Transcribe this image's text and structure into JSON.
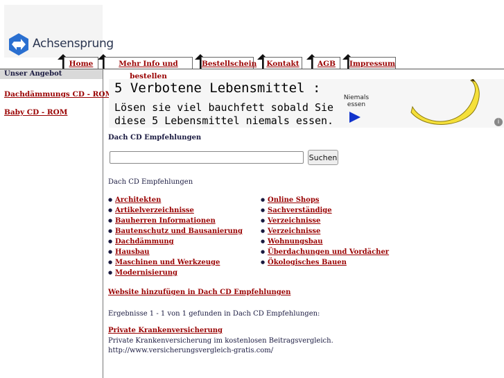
{
  "logo": {
    "text": "Achsensprung"
  },
  "nav": {
    "tabs": [
      {
        "label": "Home"
      },
      {
        "label": "Mehr Info und bestellen"
      },
      {
        "label": "Bestellschein"
      },
      {
        "label": "Kontakt"
      },
      {
        "label": "AGB"
      },
      {
        "label": "Impressum"
      }
    ]
  },
  "sidebar": {
    "heading": "Unser Angebot",
    "links": [
      {
        "label": "Dachdämmungs CD - ROM"
      },
      {
        "label": "Baby CD - ROM"
      }
    ]
  },
  "ad": {
    "line1": "5 Verbotene Lebensmittel :",
    "line2": "Lösen sie viel bauchfett sobald Sie",
    "line3": "diese 5 Lebensmittel niemals essen.",
    "cta_line1": "Niemals",
    "cta_line2": "essen",
    "info_icon": "info-icon",
    "colors": {
      "arrow": "#1133cc",
      "banana": "#f5e03a"
    }
  },
  "main": {
    "title": "Dach CD Empfehlungen",
    "search": {
      "value": "",
      "placeholder": "",
      "button_label": "Suchen"
    },
    "subtitle": "Dach CD Empfehlungen",
    "categories_left": [
      "Architekten",
      "Artikelverzeichnisse",
      "Bauherren Informationen",
      "Bautenschutz und Bausanierung",
      "Dachdämmung",
      "Hausbau",
      "Maschinen und Werkzeuge",
      "Modernisierung"
    ],
    "categories_right": [
      "Online Shops",
      "Sachverständige",
      "Verzeichnisse",
      "Verzeichnisse",
      "Wohnungsbau",
      "Überdachungen und Vordächer",
      "Ökologisches Bauen"
    ],
    "add_link": "Website hinzufügen in Dach CD Empfehlungen",
    "results_text": "Ergebnisse 1 - 1 von 1 gefunden in Dach CD Empfehlungen:",
    "result": {
      "title": "Private Krankenversicherung",
      "description": "Private Krankenversicherung im kostenlosen Beitragsvergleich.",
      "url": "http://www.versicherungsvergleich-gratis.com/"
    }
  },
  "colors": {
    "link": "#990000",
    "text": "#1a1a40",
    "sidebar_heading_bg": "#d9d9d9"
  }
}
